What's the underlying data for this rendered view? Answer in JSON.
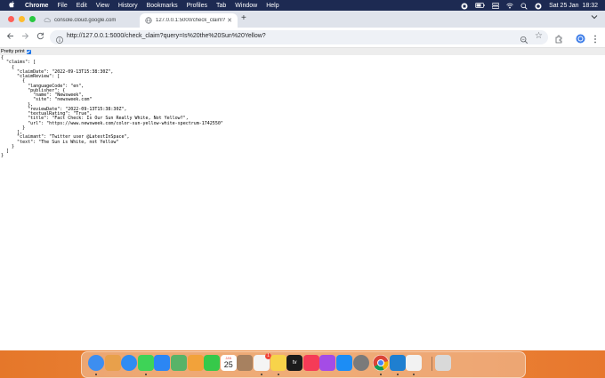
{
  "menubar": {
    "app": "Chrome",
    "items": [
      "File",
      "Edit",
      "View",
      "History",
      "Bookmarks",
      "Profiles",
      "Tab",
      "Window",
      "Help"
    ],
    "datetime": "Sat 25 Jan  18:32"
  },
  "tabs": [
    {
      "title": "console.cloud.google.com",
      "active": false
    },
    {
      "title": "127.0.0.1:5000/check_claim?",
      "active": true
    }
  ],
  "toolbar": {
    "url": "http://127.0.0.1:5000/check_claim?query=Is%20the%20Sun%20Yellow?"
  },
  "page": {
    "pretty_print_label": "Pretty print",
    "pretty_print_checked": true,
    "json_lines": [
      "{",
      "  \"claims\": [",
      "    {",
      "      \"claimDate\": \"2022-09-13T15:38:30Z\",",
      "      \"claimReview\": [",
      "        {",
      "          \"languageCode\": \"en\",",
      "          \"publisher\": {",
      "            \"name\": \"Newsweek\",",
      "            \"site\": \"newsweek.com\"",
      "          },",
      "          \"reviewDate\": \"2022-09-13T15:38:30Z\",",
      "          \"textualRating\": \"True\",",
      "          \"title\": \"Fact Check: Is Our Sun Really White, Not Yellow?\",",
      "          \"url\": \"https://www.newsweek.com/color-sun-yellow-white-spectrum-1742550\"",
      "        }",
      "      ],",
      "      \"claimant\": \"Twitter user @LatestInSpace\",",
      "      \"text\": \"The Sun is White, not Yellow\"",
      "    }",
      "  ]",
      "}"
    ]
  },
  "dock": {
    "calendar_month": "JAN",
    "calendar_day": "25",
    "mail_badge": "1",
    "apps": [
      {
        "name": "finder-icon",
        "color": "#3d8ef0"
      },
      {
        "name": "launchpad-icon",
        "color": "#e8a04b"
      },
      {
        "name": "safari-icon",
        "color": "#2f8cf2"
      },
      {
        "name": "messages-icon",
        "color": "#3ed357"
      },
      {
        "name": "mail-icon",
        "color": "#2c86f3"
      },
      {
        "name": "maps-icon",
        "color": "#58b368"
      },
      {
        "name": "photos-icon",
        "color": "#f2a23a"
      },
      {
        "name": "facetime-icon",
        "color": "#36c94a"
      },
      {
        "name": "calendar-icon",
        "color": "#ffffff"
      },
      {
        "name": "contacts-icon",
        "color": "#a78160"
      },
      {
        "name": "reminders-icon",
        "color": "#f4f4f4"
      },
      {
        "name": "notes-icon",
        "color": "#f7d34a"
      },
      {
        "name": "appletv-icon",
        "color": "#1b1b1b"
      },
      {
        "name": "music-icon",
        "color": "#f53b57"
      },
      {
        "name": "podcasts-icon",
        "color": "#a44ce6"
      },
      {
        "name": "appstore-icon",
        "color": "#1c8df5"
      },
      {
        "name": "system-settings-icon",
        "color": "#7a7a7a"
      },
      {
        "name": "chrome-icon",
        "color": "#ffffff"
      },
      {
        "name": "vscode-icon",
        "color": "#1f7fd0"
      },
      {
        "name": "textedit-icon",
        "color": "#f2f2f2"
      },
      {
        "name": "trash-icon",
        "color": "#d9d9d9"
      }
    ]
  }
}
